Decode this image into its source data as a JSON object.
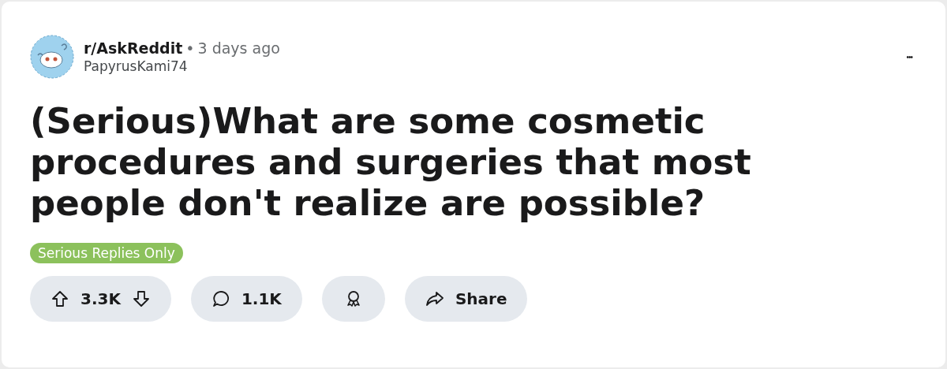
{
  "post": {
    "subreddit": "r/AskReddit",
    "separator": "•",
    "time": "3 days ago",
    "author": "PapyrusKami74",
    "more": "•••",
    "title": "(Serious)What are some cosmetic procedures and surgeries that most people don't realize are possible?",
    "flair": "Serious Replies Only"
  },
  "actions": {
    "votes": "3.3K",
    "comments": "1.1K",
    "share": "Share"
  }
}
